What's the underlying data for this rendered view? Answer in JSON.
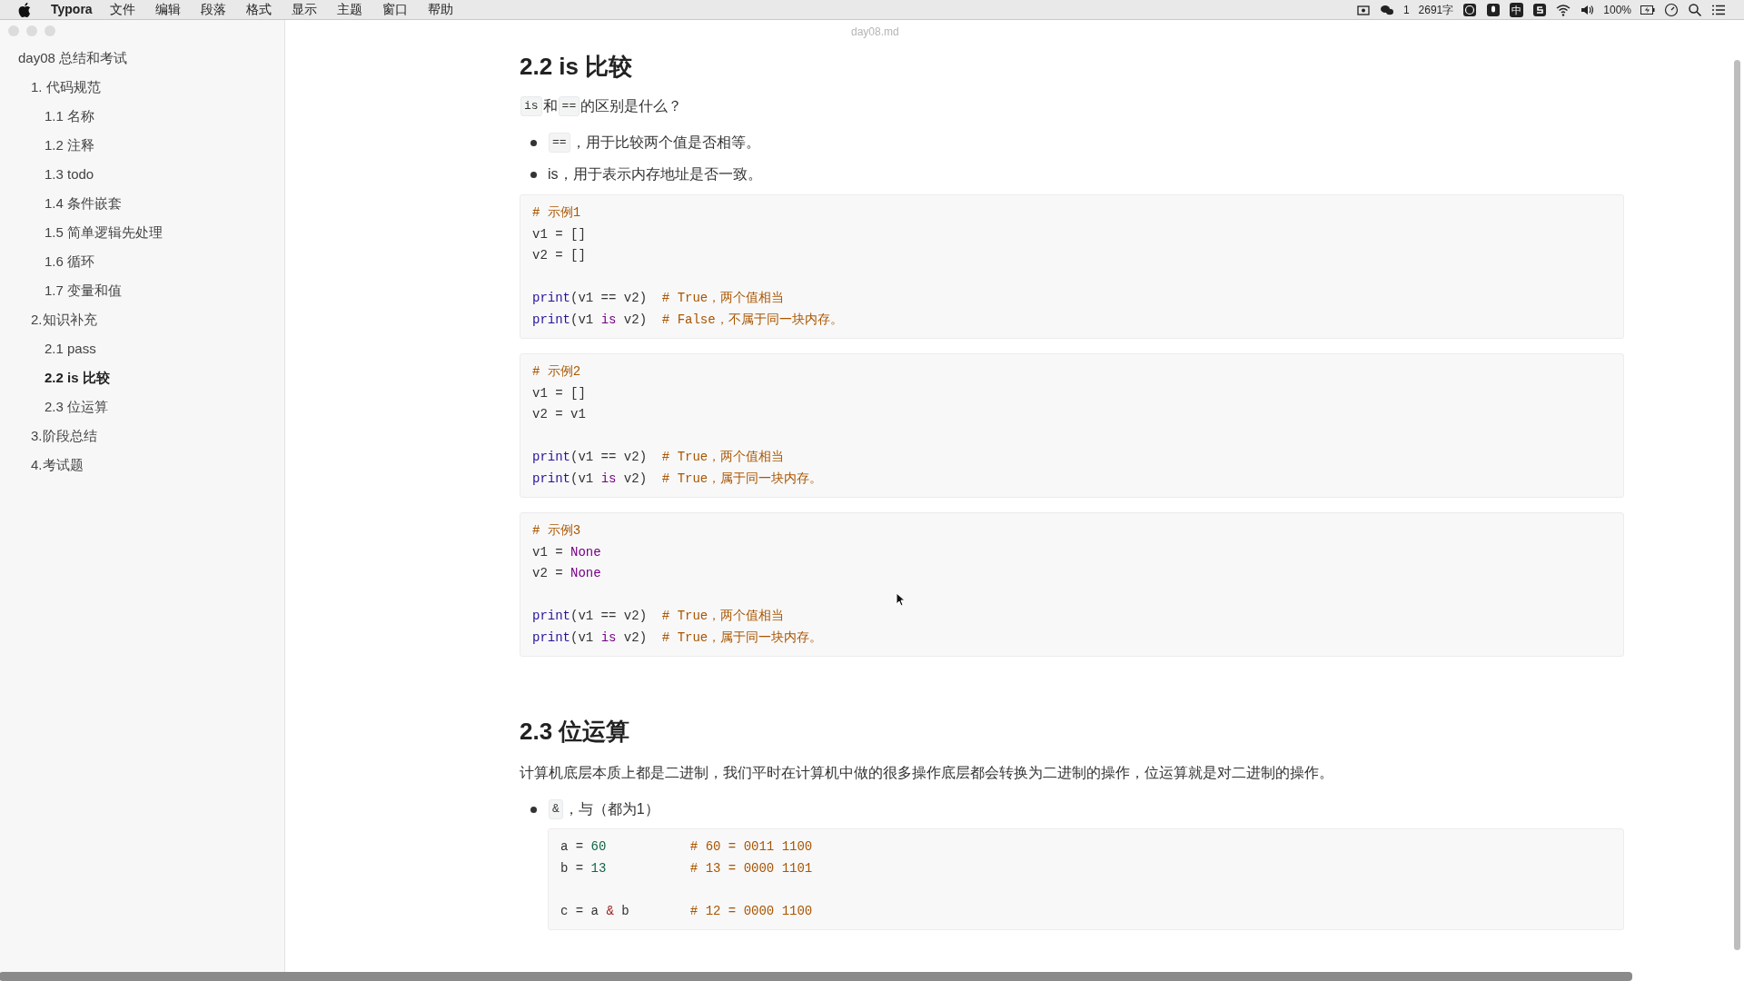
{
  "menu_bar": {
    "app": "Typora",
    "items": [
      "文件",
      "编辑",
      "段落",
      "格式",
      "显示",
      "主题",
      "窗口",
      "帮助"
    ],
    "status": [
      {
        "kind": "icon"
      },
      {
        "kind": "icon"
      },
      {
        "kind": "text",
        "text": "1"
      },
      {
        "kind": "text",
        "text": "2691字"
      },
      {
        "kind": "icon"
      },
      {
        "kind": "icon"
      },
      {
        "kind": "badge",
        "text": "中"
      },
      {
        "kind": "icon"
      },
      {
        "kind": "icon"
      },
      {
        "kind": "icon"
      },
      {
        "kind": "text",
        "text": "100%"
      },
      {
        "kind": "icon"
      },
      {
        "kind": "icon"
      },
      {
        "kind": "icon"
      },
      {
        "kind": "icon"
      }
    ]
  },
  "window": {
    "title": "day08.md"
  },
  "sidebar": {
    "items": [
      {
        "label": "day08 总结和考试",
        "selected": false,
        "children": [
          {
            "label": "1. 代码规范",
            "selected": false,
            "children": [
              {
                "label": "1.1 名称",
                "selected": false
              },
              {
                "label": "1.2 注释",
                "selected": false
              },
              {
                "label": "1.3 todo",
                "selected": false
              },
              {
                "label": "1.4 条件嵌套",
                "selected": false
              },
              {
                "label": "1.5 简单逻辑先处理",
                "selected": false
              },
              {
                "label": "1.6 循环",
                "selected": false
              },
              {
                "label": "1.7 变量和值",
                "selected": false
              }
            ]
          },
          {
            "label": "2.知识补充",
            "selected": false,
            "children": [
              {
                "label": "2.1 pass",
                "selected": false
              },
              {
                "label": "2.2 is 比较",
                "selected": true
              },
              {
                "label": "2.3 位运算",
                "selected": false
              }
            ]
          },
          {
            "label": "3.阶段总结",
            "selected": false
          },
          {
            "label": "4.考试题",
            "selected": false
          }
        ]
      }
    ]
  },
  "document": [
    {
      "kind": "heading",
      "text": "2.2 is 比较"
    },
    {
      "kind": "paragraph",
      "parts": [
        {
          "kind": "code",
          "text": "is"
        },
        {
          "kind": "text",
          "text": " 和 "
        },
        {
          "kind": "code",
          "text": "=="
        },
        {
          "kind": "text",
          "text": "的区别是什么？"
        }
      ]
    },
    {
      "kind": "bullet",
      "parts": [
        {
          "kind": "code",
          "text": "=="
        },
        {
          "kind": "text",
          "text": "，用于比较两个值是否相等。"
        }
      ]
    },
    {
      "kind": "bullet",
      "parts": [
        {
          "kind": "text",
          "text": "is，用于表示内存地址是否一致。"
        }
      ]
    },
    {
      "kind": "code",
      "lines": [
        {
          "tokens": [
            {
              "kind": "comment",
              "text": "# 示例1"
            }
          ]
        },
        {
          "tokens": [
            {
              "kind": "plain",
              "text": "v1 = []"
            }
          ]
        },
        {
          "tokens": [
            {
              "kind": "plain",
              "text": "v2 = []"
            }
          ]
        },
        {
          "kind": "blank"
        },
        {
          "tokens": [
            {
              "kind": "builtin",
              "text": "print"
            },
            {
              "kind": "plain",
              "text": "(v1 == v2)  "
            },
            {
              "kind": "comment",
              "text": "# True，两个值相当"
            }
          ]
        },
        {
          "tokens": [
            {
              "kind": "builtin",
              "text": "print"
            },
            {
              "kind": "plain",
              "text": "(v1 "
            },
            {
              "kind": "keyword",
              "text": "is"
            },
            {
              "kind": "plain",
              "text": " v2)  "
            },
            {
              "kind": "comment",
              "text": "# False，不属于同一块内存。"
            }
          ]
        }
      ]
    },
    {
      "kind": "code",
      "lines": [
        {
          "tokens": [
            {
              "kind": "comment",
              "text": "# 示例2"
            }
          ]
        },
        {
          "tokens": [
            {
              "kind": "plain",
              "text": "v1 = []"
            }
          ]
        },
        {
          "tokens": [
            {
              "kind": "plain",
              "text": "v2 = v1"
            }
          ]
        },
        {
          "kind": "blank"
        },
        {
          "tokens": [
            {
              "kind": "builtin",
              "text": "print"
            },
            {
              "kind": "plain",
              "text": "(v1 == v2)  "
            },
            {
              "kind": "comment",
              "text": "# True，两个值相当"
            }
          ]
        },
        {
          "tokens": [
            {
              "kind": "builtin",
              "text": "print"
            },
            {
              "kind": "plain",
              "text": "(v1 "
            },
            {
              "kind": "keyword",
              "text": "is"
            },
            {
              "kind": "plain",
              "text": " v2)  "
            },
            {
              "kind": "comment",
              "text": "# True，属于同一块内存。"
            }
          ]
        }
      ]
    },
    {
      "kind": "code",
      "lines": [
        {
          "tokens": [
            {
              "kind": "comment",
              "text": "# 示例3"
            }
          ]
        },
        {
          "tokens": [
            {
              "kind": "plain",
              "text": "v1 = "
            },
            {
              "kind": "keyword",
              "text": "None"
            }
          ]
        },
        {
          "tokens": [
            {
              "kind": "plain",
              "text": "v2 = "
            },
            {
              "kind": "keyword",
              "text": "None"
            }
          ]
        },
        {
          "kind": "blank"
        },
        {
          "tokens": [
            {
              "kind": "builtin",
              "text": "print"
            },
            {
              "kind": "plain",
              "text": "(v1 == v2)  "
            },
            {
              "kind": "comment",
              "text": "# True，两个值相当"
            }
          ]
        },
        {
          "tokens": [
            {
              "kind": "builtin",
              "text": "print"
            },
            {
              "kind": "plain",
              "text": "(v1 "
            },
            {
              "kind": "keyword",
              "text": "is"
            },
            {
              "kind": "plain",
              "text": " v2)  "
            },
            {
              "kind": "comment",
              "text": "# True，属于同一块内存。"
            }
          ]
        }
      ]
    },
    {
      "kind": "heading",
      "text": "2.3 位运算"
    },
    {
      "kind": "paragraph",
      "parts": [
        {
          "kind": "text",
          "text": "计算机底层本质上都是二进制，我们平时在计算机中做的很多操作底层都会转换为二进制的操作，位运算就是对二进制的操作。"
        }
      ]
    },
    {
      "kind": "bullet",
      "parts": [
        {
          "kind": "code",
          "text": "&"
        },
        {
          "kind": "text",
          "text": "，与（都为1）"
        }
      ]
    },
    {
      "kind": "indented_code",
      "lines": [
        {
          "tokens": [
            {
              "kind": "plain",
              "text": "a = "
            },
            {
              "kind": "number",
              "text": "60"
            },
            {
              "kind": "comment",
              "text": "           # 60 = 0011 1100"
            }
          ]
        },
        {
          "tokens": [
            {
              "kind": "plain",
              "text": "b = "
            },
            {
              "kind": "number",
              "text": "13"
            },
            {
              "kind": "comment",
              "text": "           # 13 = 0000 1101"
            }
          ]
        },
        {
          "kind": "blank"
        },
        {
          "tokens": [
            {
              "kind": "plain",
              "text": "c = a "
            },
            {
              "kind": "operator",
              "text": "&"
            },
            {
              "kind": "plain",
              "text": " b        "
            },
            {
              "kind": "comment",
              "text": "# 12 = 0000 1100"
            }
          ]
        }
      ]
    }
  ]
}
